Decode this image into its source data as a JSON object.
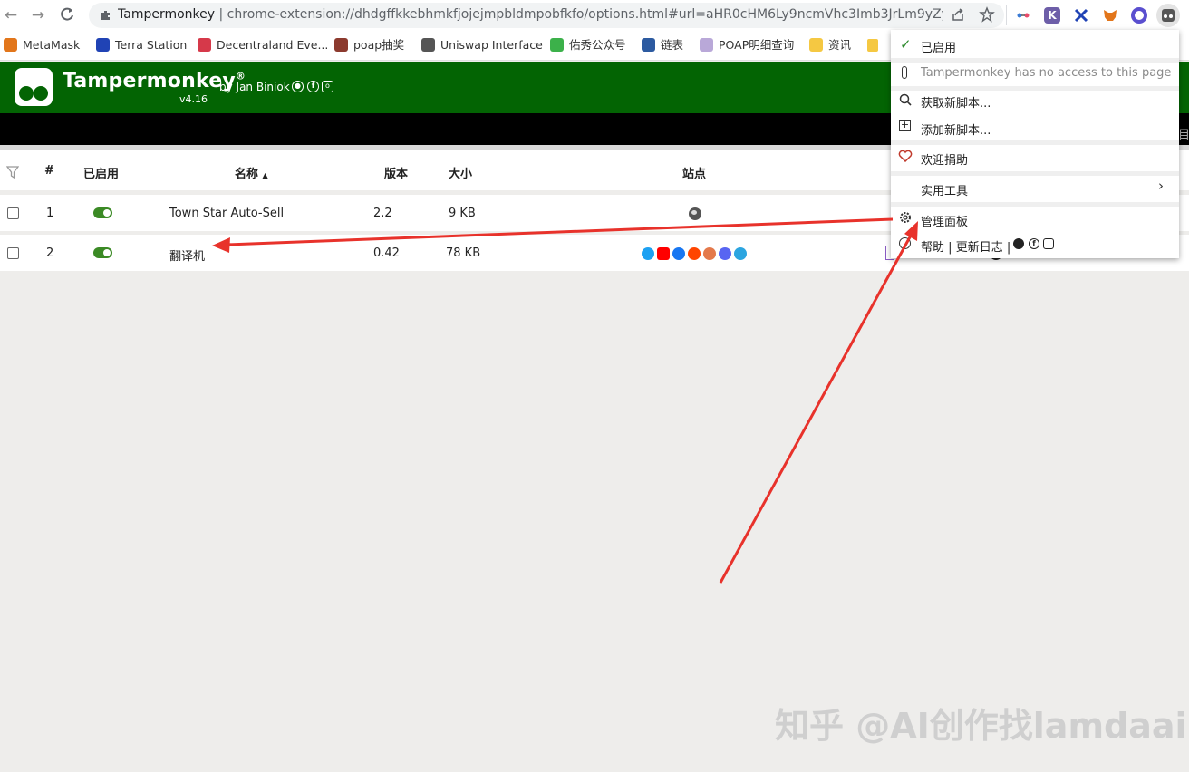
{
  "browser": {
    "url_site": "Tampermonkey",
    "url_separator": "|",
    "url_path": "chrome-extension://dhdgffkkebhmkfjojejmpbldmpobfkfo/options.html#url=aHR0cHM6Ly9ncmVhc3Imb3JrLm9yZy...",
    "nav_icons": [
      "back-arrow-icon",
      "forward-arrow-icon",
      "reload-icon"
    ],
    "extension_icons": [
      "puzzle-icon",
      "share-icon",
      "star-icon",
      "link-icon",
      "k-icon",
      "terra-icon",
      "metamask-icon",
      "circle-icon",
      "tampermonkey-icon"
    ]
  },
  "bookmarks": [
    {
      "label": "MetaMask",
      "icon": "fox-icon",
      "color": "#e2761b"
    },
    {
      "label": "Terra Station",
      "icon": "terra-icon",
      "color": "#2043b5"
    },
    {
      "label": "Decentraland Eve...",
      "icon": "decentraland-icon",
      "color": "#d6394a"
    },
    {
      "label": "poap抽奖",
      "icon": "poap-icon",
      "color": "#8c3a2e"
    },
    {
      "label": "Uniswap Interface",
      "icon": "uniswap-icon",
      "color": "#555555"
    },
    {
      "label": "佑秀公众号",
      "icon": "wechat-icon",
      "color": "#3cb14a"
    },
    {
      "label": "链表",
      "icon": "chain-icon",
      "color": "#2c5aa0"
    },
    {
      "label": "POAP明细查询",
      "icon": "poap-detail-icon",
      "color": "#b9a8d8"
    },
    {
      "label": "资讯",
      "icon": "folder-icon",
      "color": "#f5c842"
    }
  ],
  "header": {
    "title": "Tampermonkey",
    "registered": "®",
    "version": "v4.16",
    "by": "by Jan Biniok"
  },
  "table": {
    "columns": [
      "#",
      "已启用",
      "名称",
      "版本",
      "大小",
      "站点"
    ],
    "sort_indicator": "▲",
    "rows": [
      {
        "num": "1",
        "enabled": true,
        "name": "Town Star Auto-Sell",
        "version": "2.2",
        "size": "9 KB"
      },
      {
        "num": "2",
        "enabled": true,
        "name": "翻译机",
        "version": "0.42",
        "size": "78 KB"
      }
    ]
  },
  "site_icon_colors": [
    "#1da1f2",
    "#ff0000",
    "#1877f2",
    "#ff4500",
    "#e4794b",
    "#5865f2",
    "#2ca5e0"
  ],
  "popup": {
    "enabled_label": "已启用",
    "no_access": "Tampermonkey has no access to this page",
    "get_scripts": "获取新脚本...",
    "add_script": "添加新脚本...",
    "donate": "欢迎捐助",
    "utilities": "实用工具",
    "dashboard": "管理面板",
    "help": "帮助",
    "sep1": "|",
    "changelog": "更新日志",
    "sep2": "|"
  },
  "partial_right_text": "目",
  "watermark": "知乎 @AI创作找lamdaai",
  "annotation_color": "#e8322b"
}
